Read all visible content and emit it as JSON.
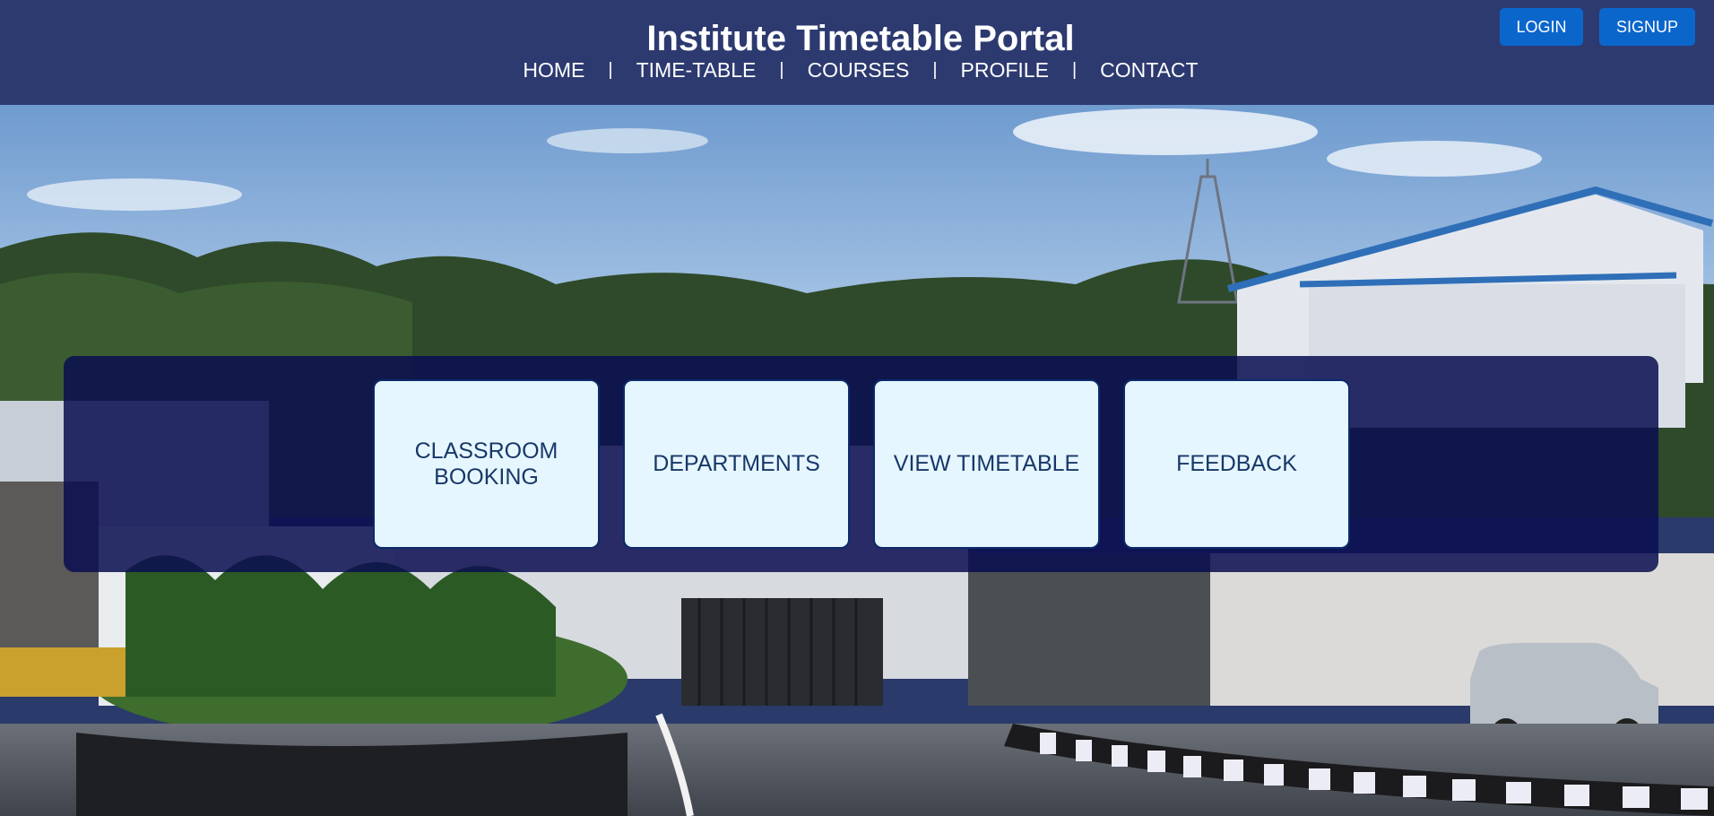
{
  "header": {
    "title": "Institute Timetable Portal",
    "nav": {
      "home": "HOME",
      "timetable": "TIME-TABLE",
      "courses": "COURSES",
      "profile": "PROFILE",
      "contact": "CONTACT",
      "separator": "|"
    },
    "login_label": "LOGIN",
    "signup_label": "SIGNUP"
  },
  "tiles": {
    "classroom_booking": "CLASSROOM BOOKING",
    "departments": "DEPARTMENTS",
    "view_timetable": "VIEW TIMETABLE",
    "feedback": "FEEDBACK"
  },
  "colors": {
    "header_bg": "#2d3a70",
    "button_bg": "#0b66cc",
    "panel_bg": "#0a0e50",
    "tile_bg": "#e6f6ff",
    "tile_text": "#173868"
  }
}
